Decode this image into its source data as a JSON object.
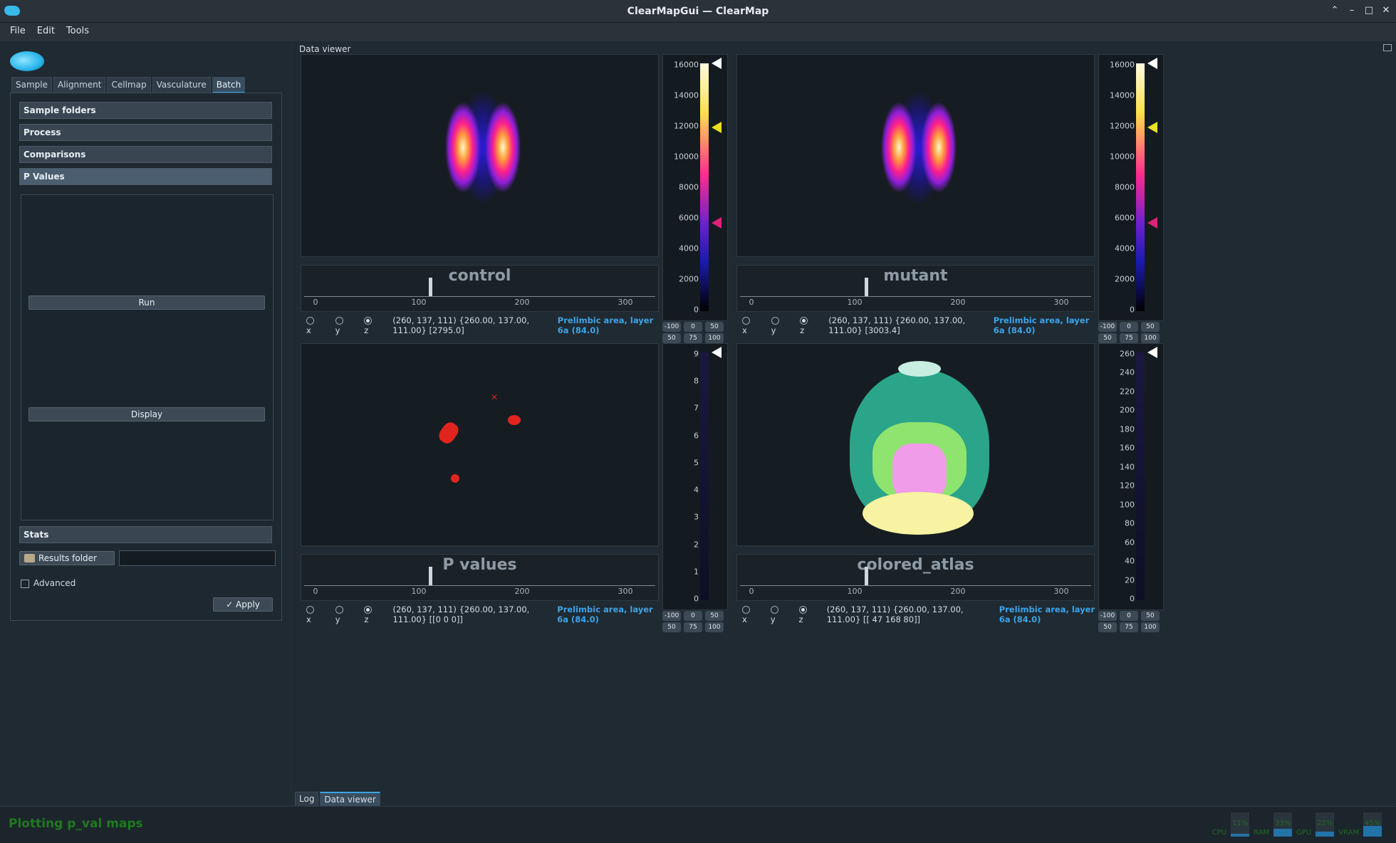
{
  "window": {
    "title": "ClearMapGui — ClearMap",
    "controls": [
      "⌃",
      "–",
      "□",
      "✕"
    ]
  },
  "menu": [
    "File",
    "Edit",
    "Tools"
  ],
  "left": {
    "tabs": [
      "Sample",
      "Alignment",
      "Cellmap",
      "Vasculature",
      "Batch"
    ],
    "active_tab": "Batch",
    "sections": {
      "sample_folders": "Sample folders",
      "process": "Process",
      "comparisons": "Comparisons",
      "p_values": "P Values",
      "stats": "Stats"
    },
    "run_label": "Run",
    "display_label": "Display",
    "results_folder_label": "Results folder",
    "results_folder_value": "",
    "advanced_label": "Advanced",
    "apply_label": "✓ Apply"
  },
  "viewer": {
    "title": "Data viewer",
    "panes": [
      {
        "name": "control",
        "coords": "(260, 137, 111) {260.00, 137.00, 111.00} [2795.0]",
        "region": "Prelimbic area, layer 6a (84.0)",
        "cb_ticks": [
          "16000",
          "14000",
          "12000",
          "10000",
          "8000",
          "6000",
          "4000",
          "2000",
          "0"
        ]
      },
      {
        "name": "mutant",
        "coords": "(260, 137, 111) {260.00, 137.00, 111.00} [3003.4]",
        "region": "Prelimbic area, layer 6a (84.0)",
        "cb_ticks": [
          "16000",
          "14000",
          "12000",
          "10000",
          "8000",
          "6000",
          "4000",
          "2000",
          "0"
        ]
      },
      {
        "name": "P values",
        "coords": "(260, 137, 111) {260.00, 137.00, 111.00} [[0 0 0]]",
        "region": "Prelimbic area, layer 6a (84.0)",
        "cb_ticks": [
          "9",
          "8",
          "7",
          "6",
          "5",
          "4",
          "3",
          "2",
          "1",
          "0"
        ]
      },
      {
        "name": "colored_atlas",
        "coords": "(260, 137, 111) {260.00, 137.00, 111.00} [[ 47 168 80]]",
        "region": "Prelimbic area, layer 6a (84.0)",
        "cb_ticks": [
          "260",
          "240",
          "220",
          "200",
          "180",
          "160",
          "140",
          "120",
          "100",
          "80",
          "60",
          "40",
          "20",
          "0"
        ]
      }
    ],
    "axis_ticks": [
      "0",
      "100",
      "200",
      "300"
    ],
    "slice_value": 111,
    "radio": [
      "x",
      "y",
      "z"
    ],
    "range_buttons": [
      "-100",
      "0",
      "50",
      "50",
      "75",
      "100"
    ]
  },
  "bottom_tabs": [
    "Log",
    "Data viewer"
  ],
  "status": {
    "text": "Plotting p_val maps",
    "gauges": [
      "CPU",
      "11%",
      "RAM",
      "33%",
      "GPU",
      "22%",
      "VRAM",
      "45%"
    ]
  }
}
